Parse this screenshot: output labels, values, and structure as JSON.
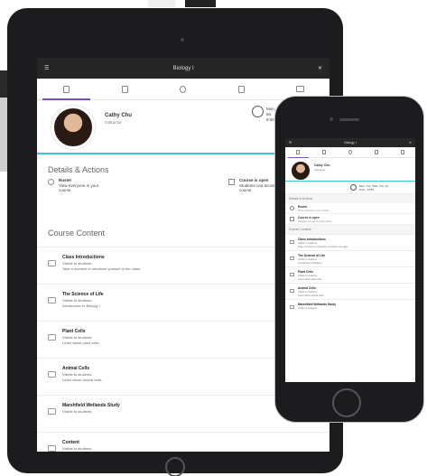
{
  "header": {
    "title": "Biology I"
  },
  "profile": {
    "name": "Cathy Chu",
    "role": "Instructor"
  },
  "schedule": {
    "line1": "Mon, Tue, Wed, Thu, Fri",
    "line2": "8a",
    "line3": "9:40-10:55"
  },
  "phone_schedule": {
    "line1": "Mon, Tue, Wed, Thu, Fri",
    "line2": "9:40 - 10:55"
  },
  "details": {
    "title": "Details & Actions",
    "roster_label": "Roster",
    "roster_sub1": "View everyone in your",
    "roster_sub2": "course",
    "course_is_label": "Course is open",
    "course_is_sub1": "Students can access this",
    "course_is_sub2": "course",
    "phone_roster_sub": "View everyone in your course",
    "phone_course_sub": "Students can access this course"
  },
  "content": {
    "title": "Course Content",
    "items": [
      {
        "title": "Class Introductions",
        "line1": "Visible to students",
        "line2": "Take a moment to introduce yourself to the class."
      },
      {
        "title": "The Science of Life",
        "line1": "Visible to students",
        "line2": "Introduction to Biology I"
      },
      {
        "title": "Plant Cells",
        "line1": "Visible to students",
        "line2": "Learn about plant cells."
      },
      {
        "title": "Animal Cells",
        "line1": "Visible to students",
        "line2": "Learn about animal cells."
      },
      {
        "title": "Marshfield Wetlands Study",
        "line1": "Visible to students",
        "line2": ""
      },
      {
        "title": "Content",
        "line1": "Visible to students",
        "line2": ""
      }
    ]
  },
  "icons": {
    "menu": "menu-icon",
    "close": "close-icon",
    "tabs": [
      "content-tab-icon",
      "calendar-tab-icon",
      "discussions-tab-icon",
      "gradebook-tab-icon",
      "messages-tab-icon"
    ]
  },
  "colors": {
    "accent_purple": "#7a4fb5",
    "accent_cyan": "#38c7d6",
    "header_dark": "#262626"
  }
}
